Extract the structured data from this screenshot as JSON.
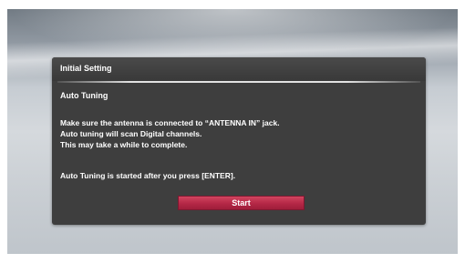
{
  "dialog": {
    "title": "Initial Setting",
    "section_title": "Auto Tuning",
    "message_lines": [
      "Make sure the antenna is connected to “ANTENNA IN” jack.",
      "Auto tuning will scan Digital channels.",
      "This may take a while to complete."
    ],
    "instruction": "Auto Tuning is started after you press [ENTER].",
    "start_label": "Start"
  },
  "colors": {
    "dialog_background": "#3e3e3e",
    "button_accent": "#b42746",
    "text": "#ffffff"
  }
}
